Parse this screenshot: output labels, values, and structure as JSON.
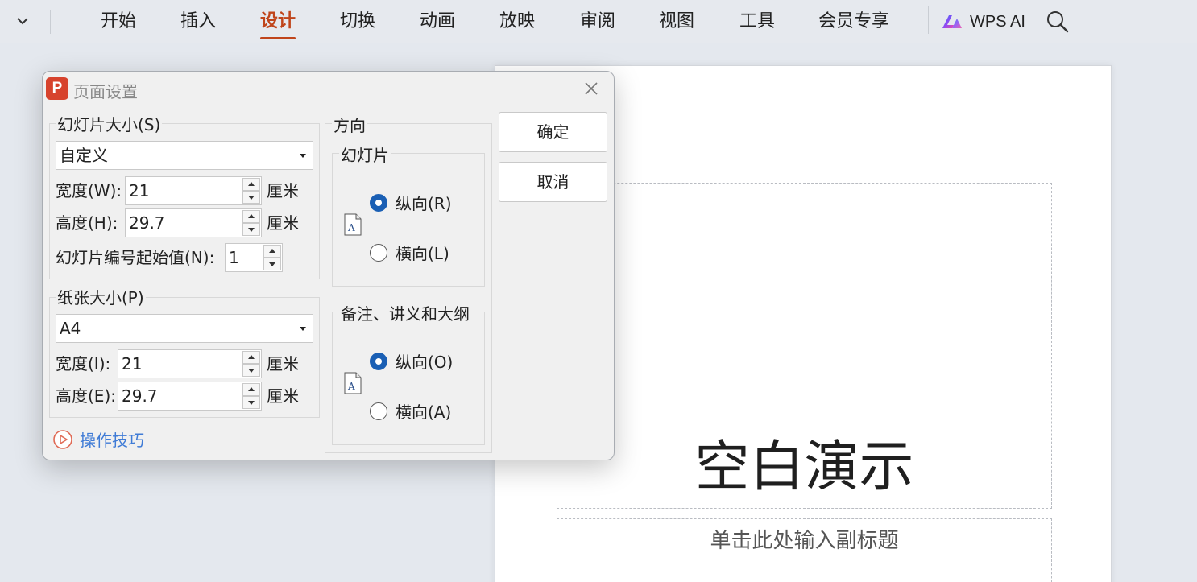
{
  "ribbon": {
    "tabs": [
      "开始",
      "插入",
      "设计",
      "切换",
      "动画",
      "放映",
      "审阅",
      "视图",
      "工具",
      "会员专享"
    ],
    "active_tab": "设计",
    "wps_ai_label": "WPS AI"
  },
  "slide": {
    "title": "空白演示",
    "subtitle_placeholder": "单击此处输入副标题"
  },
  "dialog": {
    "app_icon_letter": "P",
    "title": "页面设置",
    "slide_size": {
      "group_label": "幻灯片大小(S)",
      "selected": "自定义",
      "width_label": "宽度(W):",
      "width_value": "21",
      "height_label": "高度(H):",
      "height_value": "29.7",
      "unit": "厘米",
      "start_number_label": "幻灯片编号起始值(N):",
      "start_number_value": "1"
    },
    "paper_size": {
      "group_label": "纸张大小(P)",
      "selected": "A4",
      "width_label": "宽度(I):",
      "width_value": "21",
      "height_label": "高度(E):",
      "height_value": "29.7",
      "unit": "厘米"
    },
    "orientation": {
      "group_label": "方向",
      "slides": {
        "label": "幻灯片",
        "portrait": "纵向(R)",
        "landscape": "横向(L)",
        "selected": "portrait"
      },
      "notes": {
        "label": "备注、讲义和大纲",
        "portrait": "纵向(O)",
        "landscape": "横向(A)",
        "selected": "portrait"
      }
    },
    "ok_label": "确定",
    "cancel_label": "取消",
    "tips_label": "操作技巧"
  },
  "colors": {
    "accent": "#c0451b",
    "radio_checked": "#1a5fb4",
    "link": "#3f7bd6",
    "app_icon": "#d7432d"
  },
  "icons": [
    "chevron-down-icon",
    "wps-ai-logo-icon",
    "search-icon",
    "close-icon",
    "page-portrait-icon",
    "play-circle-icon"
  ]
}
